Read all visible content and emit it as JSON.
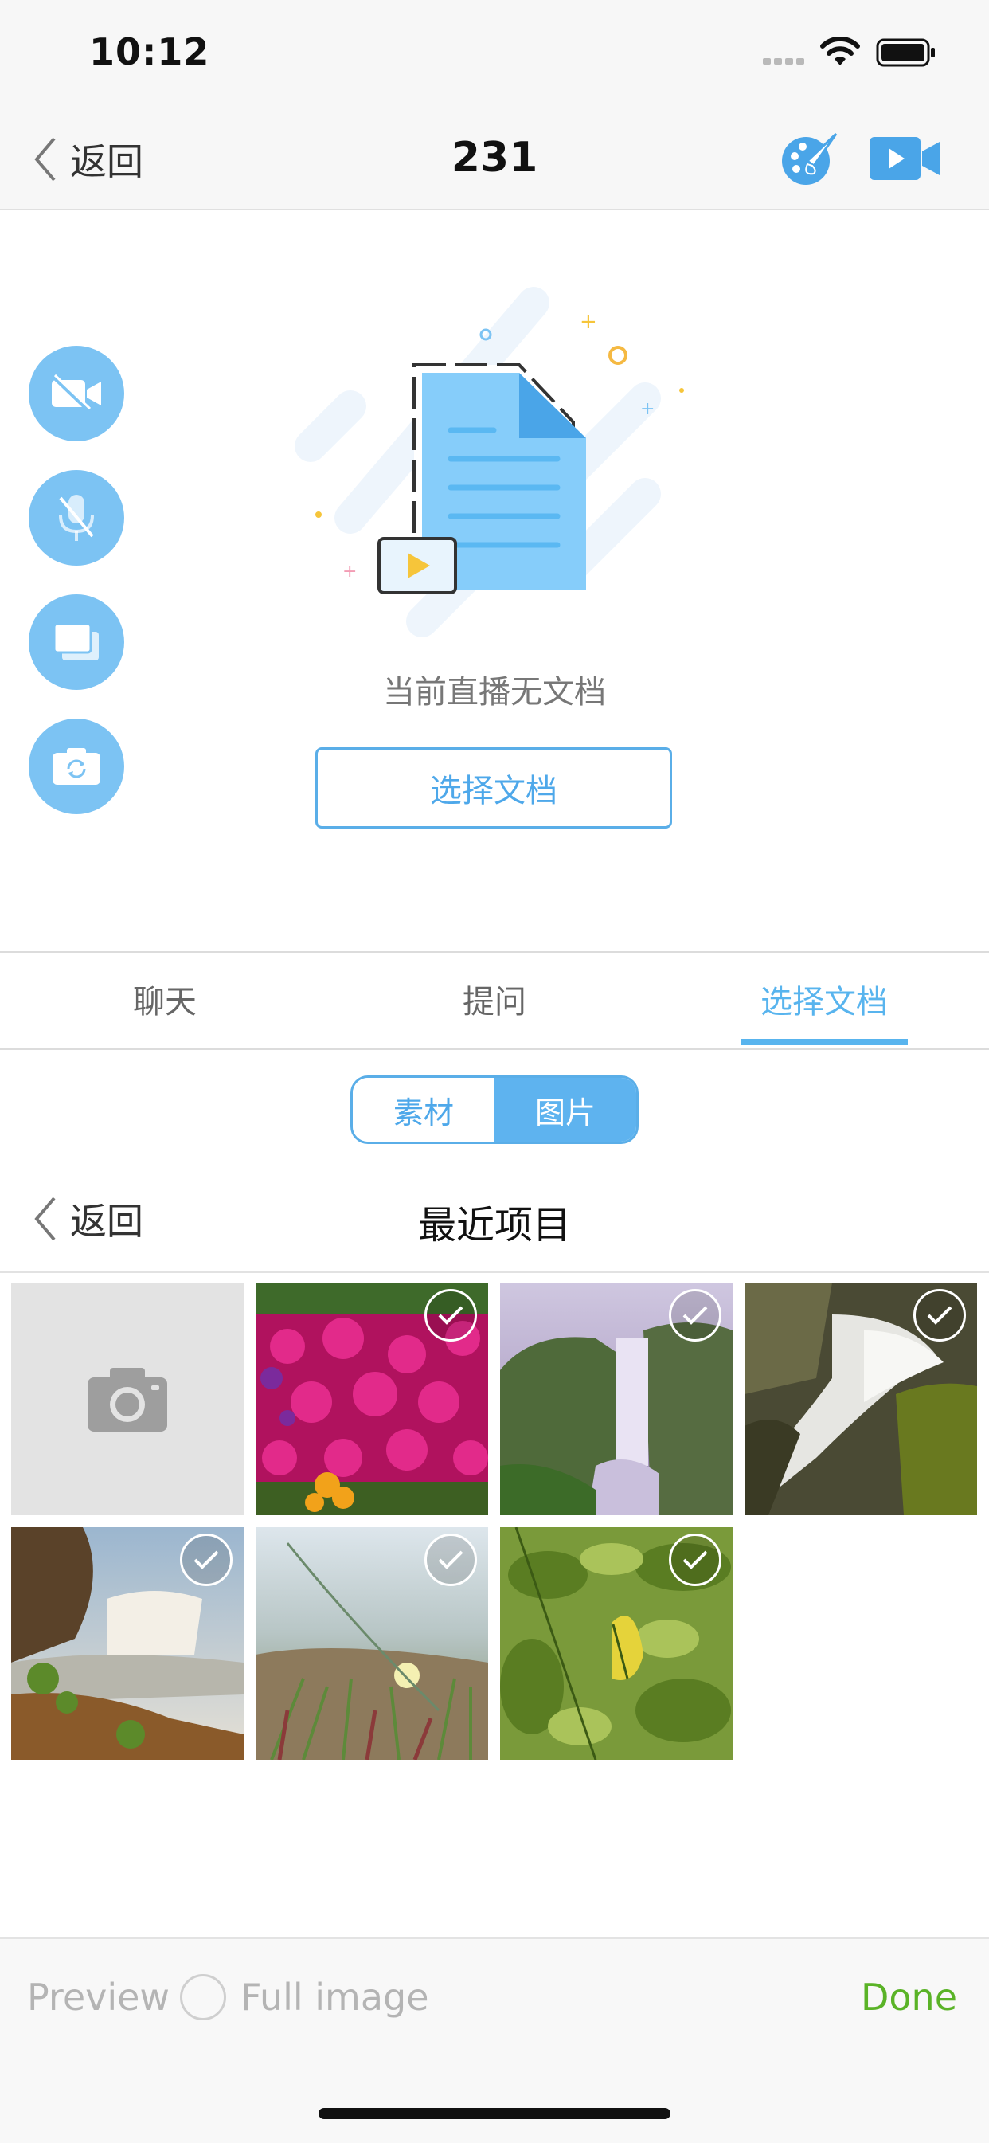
{
  "status_bar": {
    "time": "10:12"
  },
  "nav": {
    "back_label": "返回",
    "title": "231"
  },
  "doc_area": {
    "empty_text": "当前直播无文档",
    "select_button": "选择文档"
  },
  "tabs": [
    {
      "label": "聊天"
    },
    {
      "label": "提问"
    },
    {
      "label": "选择文档",
      "active": true
    }
  ],
  "segment": {
    "material": "素材",
    "image": "图片",
    "selected": "图片"
  },
  "album": {
    "back_label": "返回",
    "title": "最近项目"
  },
  "photos": [
    {
      "name": "camera-cell"
    },
    {
      "name": "photo-flowers",
      "selected": true
    },
    {
      "name": "photo-waterfall-1",
      "selected": true
    },
    {
      "name": "photo-waterfall-2",
      "selected": true
    },
    {
      "name": "photo-waterfall-3",
      "selected": true
    },
    {
      "name": "photo-grass",
      "selected": true
    },
    {
      "name": "photo-leaf",
      "selected": true
    }
  ],
  "toolbar": {
    "preview": "Preview",
    "full_image": "Full image",
    "done": "Done"
  },
  "colors": {
    "accent": "#58b4ee",
    "done": "#5ab327",
    "side_button": "#7cc3f3"
  }
}
